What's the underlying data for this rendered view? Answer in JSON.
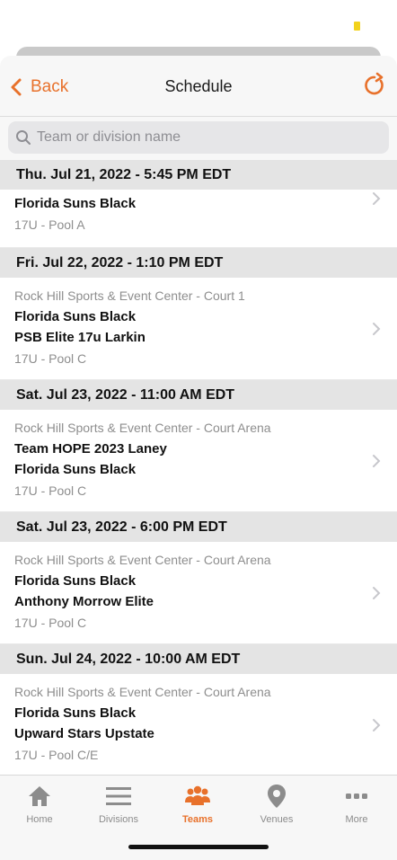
{
  "nav": {
    "back_label": "Back",
    "title": "Schedule"
  },
  "search": {
    "placeholder": "Team or division name"
  },
  "days": [
    {
      "header": "Thu. Jul 21, 2022 - 5:45 PM EDT",
      "games": [
        {
          "venue": "",
          "teams": [
            "Florida Suns Black"
          ],
          "pool": "17U - Pool A"
        }
      ]
    },
    {
      "header": "Fri. Jul 22, 2022 - 1:10 PM EDT",
      "games": [
        {
          "venue": "Rock Hill Sports & Event Center - Court 1",
          "teams": [
            "Florida Suns Black",
            "PSB Elite 17u Larkin"
          ],
          "pool": "17U - Pool C"
        }
      ]
    },
    {
      "header": "Sat. Jul 23, 2022 - 11:00 AM EDT",
      "games": [
        {
          "venue": "Rock Hill Sports & Event Center - Court Arena",
          "teams": [
            "Team HOPE 2023 Laney",
            "Florida Suns Black"
          ],
          "pool": "17U - Pool C"
        }
      ]
    },
    {
      "header": "Sat. Jul 23, 2022 - 6:00 PM EDT",
      "games": [
        {
          "venue": "Rock Hill Sports & Event Center - Court Arena",
          "teams": [
            "Florida Suns Black",
            "Anthony Morrow Elite"
          ],
          "pool": "17U - Pool C"
        }
      ]
    },
    {
      "header": "Sun. Jul 24, 2022 - 10:00 AM EDT",
      "games": [
        {
          "venue": "Rock Hill Sports & Event Center - Court Arena",
          "teams": [
            "Florida Suns Black",
            "Upward Stars Upstate"
          ],
          "pool": "17U - Pool C/E"
        }
      ]
    }
  ],
  "tabs": [
    {
      "label": "Home",
      "icon": "home-icon"
    },
    {
      "label": "Divisions",
      "icon": "list-icon"
    },
    {
      "label": "Teams",
      "icon": "users-icon",
      "active": true
    },
    {
      "label": "Venues",
      "icon": "location-pin-icon"
    },
    {
      "label": "More",
      "icon": "more-dots-icon"
    }
  ],
  "colors": {
    "accent": "#e8712b",
    "header_bg": "#e4e4e4",
    "muted_text": "#8e8e8e"
  }
}
